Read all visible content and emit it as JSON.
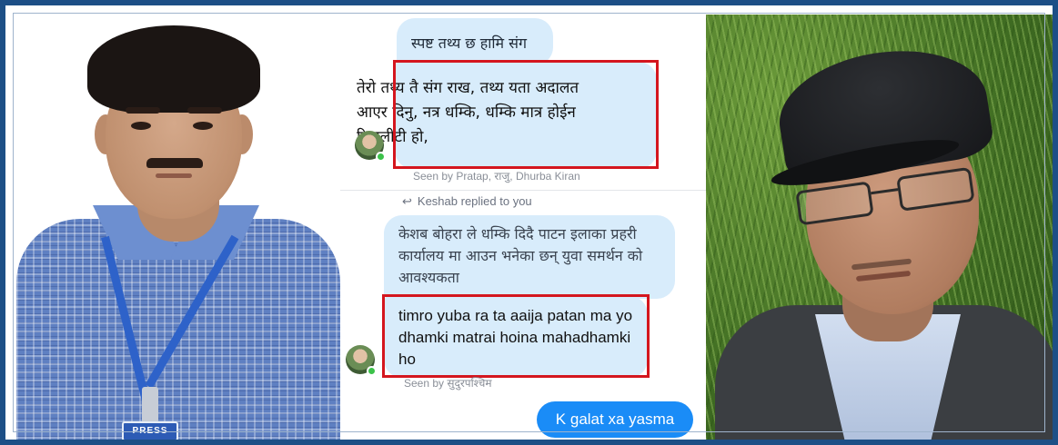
{
  "left_photo": {
    "badge_text": "PRESS"
  },
  "chat": {
    "messages": [
      {
        "text": "स्पष्ट तथ्य छ हामि संग"
      },
      {
        "text": "तेरो तथ्य तै संग राख, तथ्य यता अदालत आएर दिनु, नत्र धम्कि, धम्कि मात्र होईन रियालीटी हो,"
      },
      {
        "text": "केशब बोहरा ले धम्कि  दिदै पाटन इलाका प्रहरी कार्यालय मा आउन भनेका छन् युवा समर्थन को आवश्यकता"
      },
      {
        "text": "timro yuba ra ta aaija patan ma yo dhamki matrai hoina mahadhamki ho"
      },
      {
        "text": "K galat xa yasma"
      }
    ],
    "seen_1": "Seen by Pratap, राजु, Dhurba Kiran",
    "reply_note": "Keshab replied to you",
    "seen_2": "Seen by सुदुरपश्चिम"
  },
  "colors": {
    "frame_border": "#1d4f86",
    "received_bubble": "#d8ecfb",
    "sent_bubble": "#1a8cf7",
    "highlight_box": "#d4161e",
    "online_dot": "#3cc24a"
  },
  "icons": {
    "reply": "reply-arrow-icon",
    "online_status": "online-dot-icon"
  }
}
